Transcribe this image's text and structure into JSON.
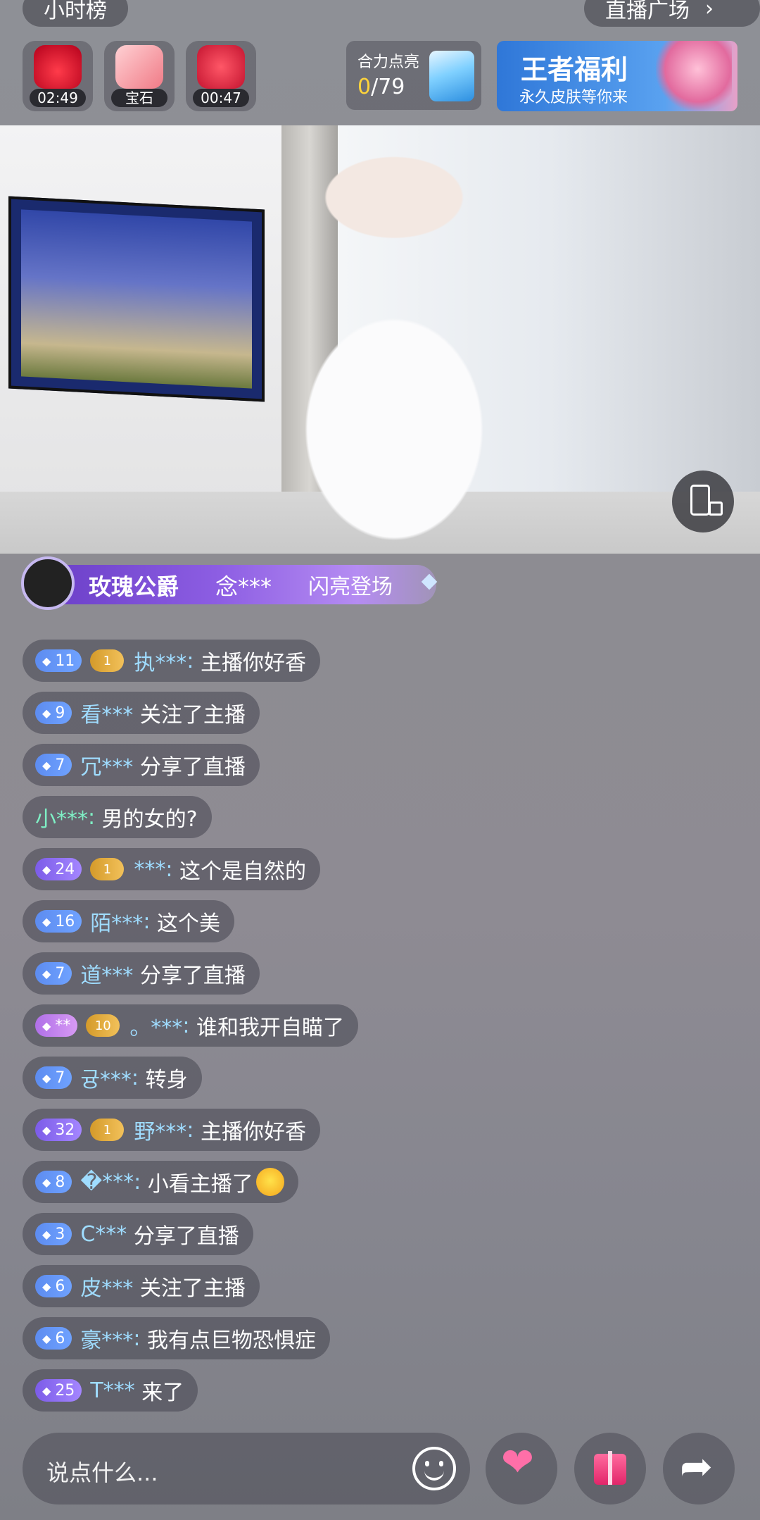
{
  "top": {
    "rank_label": "小时榜",
    "plaza_label": "直播广场",
    "boxes": [
      {
        "icon": "red-lucky-bag-icon",
        "caption": "02:49"
      },
      {
        "icon": "gem-scroll-icon",
        "caption": "宝石"
      },
      {
        "icon": "red-envelope-timer-icon",
        "caption": "00:47"
      }
    ],
    "unite": {
      "title": "合力点亮",
      "current": "0",
      "total": "/79",
      "icon": "cruise-ship-icon"
    },
    "welfare": {
      "title": "王者福利",
      "subtitle": "永久皮肤等你来"
    }
  },
  "entry": {
    "level": "玫瑰公爵",
    "name": "念***",
    "action": "闪亮登场"
  },
  "chat": [
    {
      "badge": "11",
      "badge_style": "blue",
      "fan": "1",
      "user": "执***",
      "sep": ": ",
      "text": "主播你好香"
    },
    {
      "badge": "9",
      "badge_style": "blue",
      "fan": "",
      "user": "看***",
      "sep": " ",
      "text": "关注了主播"
    },
    {
      "badge": "7",
      "badge_style": "blue",
      "fan": "",
      "user": "冗***",
      "sep": " ",
      "text": "分享了直播"
    },
    {
      "badge": "",
      "badge_style": "",
      "fan": "",
      "user": "小***",
      "sep": ": ",
      "text": "男的女的?",
      "user_style": "green"
    },
    {
      "badge": "24",
      "badge_style": "purple",
      "fan": "1",
      "user": "***",
      "sep": ": ",
      "text": "这个是自然的"
    },
    {
      "badge": "16",
      "badge_style": "blue",
      "fan": "",
      "user": "陌***",
      "sep": ": ",
      "text": "这个美"
    },
    {
      "badge": "7",
      "badge_style": "blue",
      "fan": "",
      "user": "道***",
      "sep": " ",
      "text": "分享了直播"
    },
    {
      "badge": "**",
      "badge_style": "pink",
      "fan": "10",
      "user": "。***",
      "sep": ": ",
      "text": "谁和我开自瞄了"
    },
    {
      "badge": "7",
      "badge_style": "blue",
      "fan": "",
      "user": "귱***",
      "sep": ": ",
      "text": "转身"
    },
    {
      "badge": "32",
      "badge_style": "purple",
      "fan": "1",
      "user": "野***",
      "sep": ": ",
      "text": "主播你好香"
    },
    {
      "badge": "8",
      "badge_style": "blue",
      "fan": "",
      "user": "�***",
      "sep": ": ",
      "text": "小看主播了",
      "emoji": "laughing-crying-emoji"
    },
    {
      "badge": "3",
      "badge_style": "blue",
      "fan": "",
      "user": "C***",
      "sep": " ",
      "text": "分享了直播"
    },
    {
      "badge": "6",
      "badge_style": "blue",
      "fan": "",
      "user": "皮***",
      "sep": " ",
      "text": "关注了主播"
    },
    {
      "badge": "6",
      "badge_style": "blue",
      "fan": "",
      "user": "豪***",
      "sep": ": ",
      "text": "我有点巨物恐惧症"
    },
    {
      "badge": "25",
      "badge_style": "purple",
      "fan": "",
      "user": "T***",
      "sep": " ",
      "text": "来了"
    }
  ],
  "bottom": {
    "placeholder": "说点什么..."
  },
  "colors": {
    "username": "#9fdcff",
    "entry_banner": "#8d5ee3",
    "fan_badge": "#f2c15a"
  }
}
